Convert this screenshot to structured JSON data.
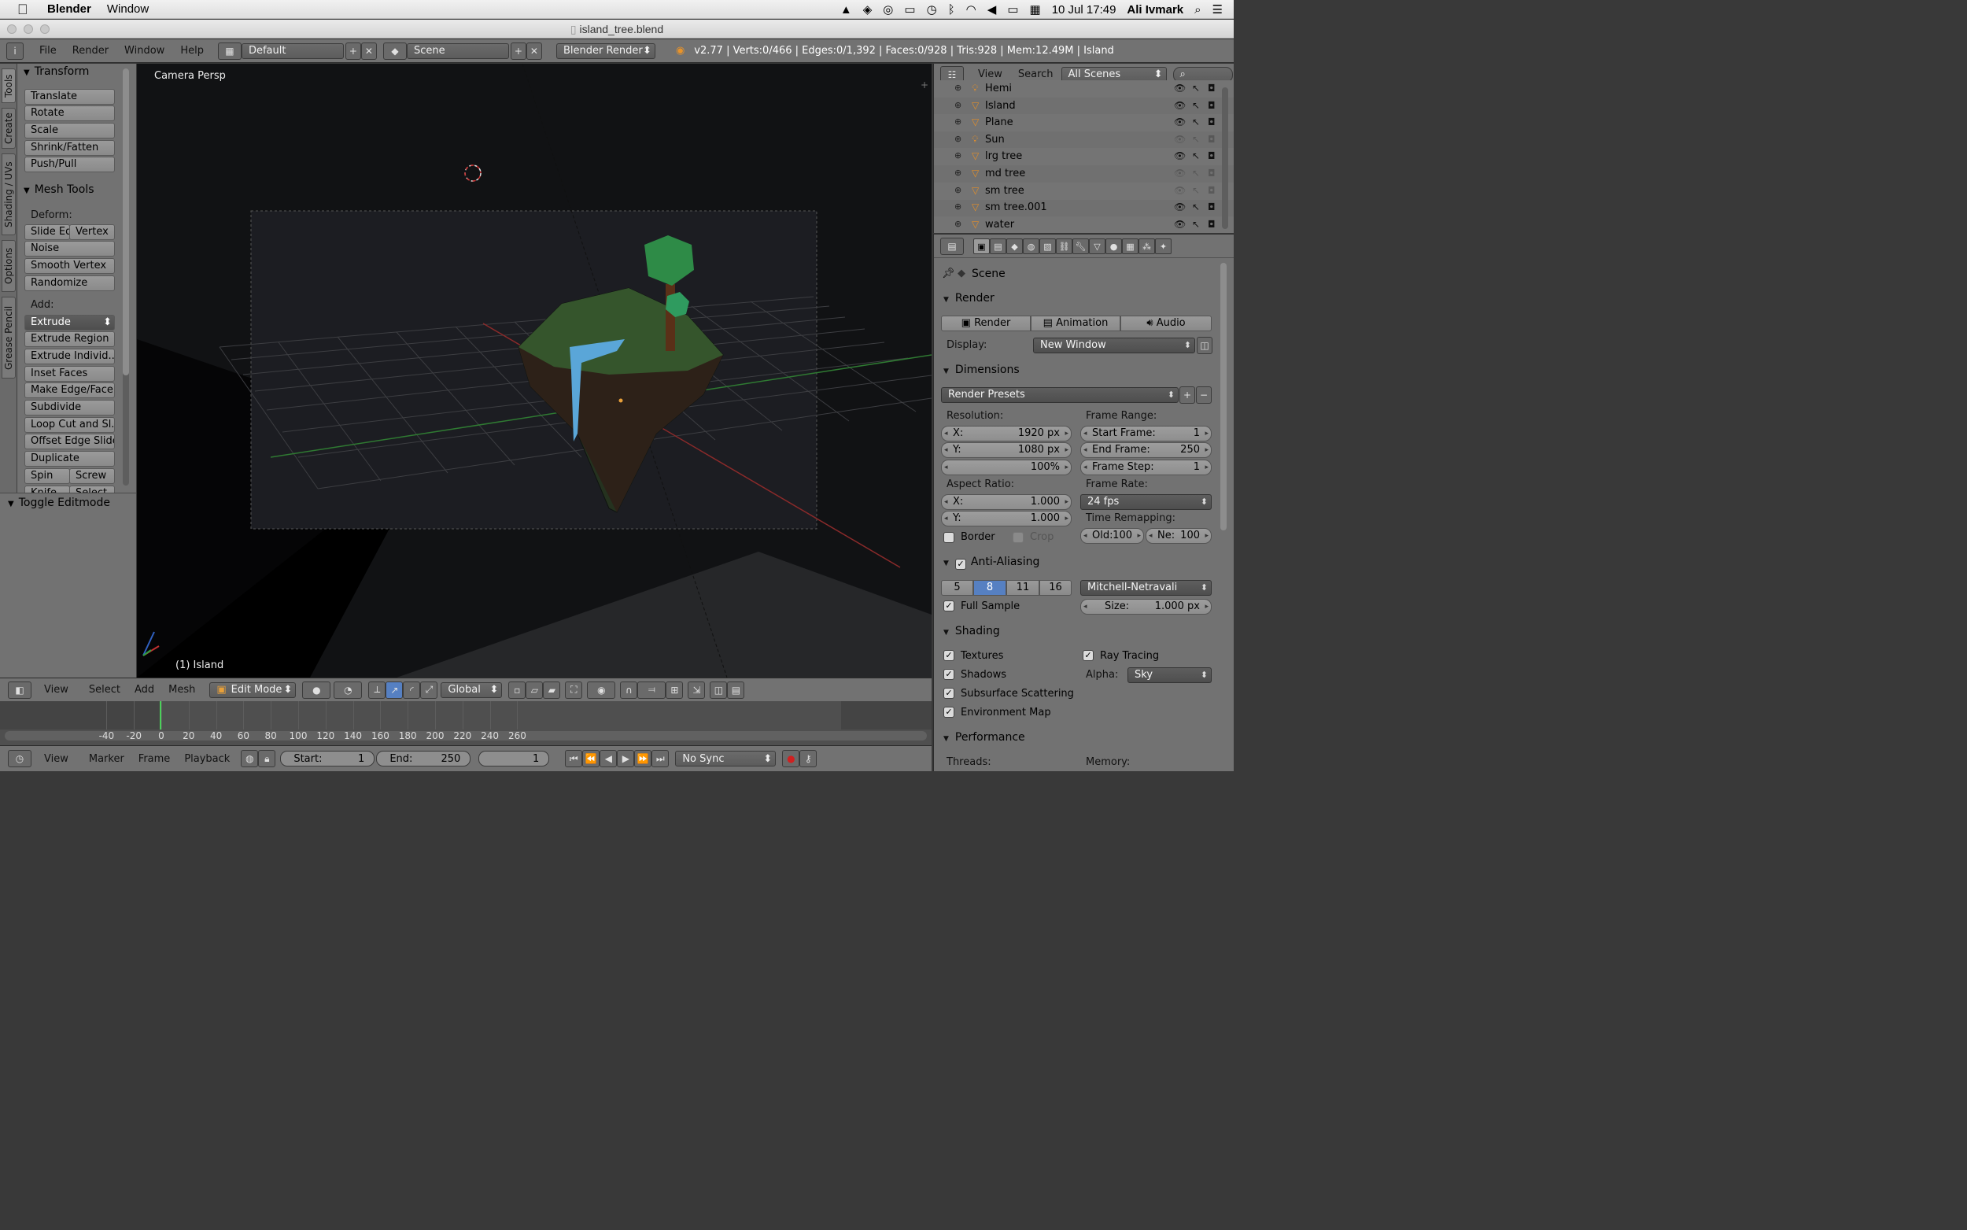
{
  "macbar": {
    "app_name": "Blender",
    "menu_window": "Window",
    "date_time": "10 Jul 17:49",
    "user": "Ali Ivmark"
  },
  "window": {
    "title": "island_tree.blend"
  },
  "infobar": {
    "menus": [
      "File",
      "Render",
      "Window",
      "Help"
    ],
    "screen_layout": "Default",
    "scene": "Scene",
    "engine": "Blender Render",
    "stats": "v2.77 | Verts:0/466 | Edges:0/1,392 | Faces:0/928 | Tris:928 | Mem:12.49M | Island"
  },
  "left_tabs": [
    "Tools",
    "Create",
    "Shading / UVs",
    "Options",
    "Grease Pencil"
  ],
  "toolshelf": {
    "transform": {
      "title": "Transform",
      "buttons": [
        "Translate",
        "Rotate",
        "Scale",
        "Shrink/Fatten",
        "Push/Pull"
      ]
    },
    "mesh_tools": {
      "title": "Mesh Tools",
      "deform_label": "Deform:",
      "slide_edge": "Slide Ed",
      "vertex": "Vertex",
      "deform_buttons": [
        "Noise",
        "Smooth Vertex",
        "Randomize"
      ],
      "add_label": "Add:",
      "extrude": "Extrude",
      "add_buttons": [
        "Extrude Region",
        "Extrude Individ...",
        "Inset Faces",
        "Make Edge/Face",
        "Subdivide",
        "Loop Cut and Sl...",
        "Offset Edge Slide",
        "Duplicate"
      ],
      "spin": "Spin",
      "screw": "Screw",
      "knife": "Knife",
      "select": "Select"
    },
    "operator": "Toggle Editmode"
  },
  "viewport": {
    "label": "Camera Persp",
    "object_label": "(1) Island"
  },
  "view3d_header": {
    "menus": [
      "View",
      "Select",
      "Add",
      "Mesh"
    ],
    "mode": "Edit Mode",
    "orientation": "Global"
  },
  "timeline": {
    "ticks": [
      -40,
      -20,
      0,
      20,
      40,
      60,
      80,
      100,
      120,
      140,
      160,
      180,
      200,
      220,
      240,
      260
    ],
    "menus": [
      "View",
      "Marker",
      "Frame",
      "Playback"
    ],
    "start_label": "Start:",
    "start_value": "1",
    "end_label": "End:",
    "end_value": "250",
    "current_frame": "1",
    "sync": "No Sync"
  },
  "outliner": {
    "menus": [
      "View",
      "Search"
    ],
    "filter": "All Scenes",
    "items": [
      {
        "name": "Hemi",
        "type": "lamp",
        "visible": true
      },
      {
        "name": "Island",
        "type": "mesh",
        "visible": true
      },
      {
        "name": "Plane",
        "type": "mesh",
        "visible": true
      },
      {
        "name": "Sun",
        "type": "lamp",
        "visible": false
      },
      {
        "name": "lrg tree",
        "type": "mesh",
        "visible": true
      },
      {
        "name": "md tree",
        "type": "mesh",
        "visible": false
      },
      {
        "name": "sm tree",
        "type": "mesh",
        "visible": false
      },
      {
        "name": "sm tree.001",
        "type": "mesh",
        "visible": true
      },
      {
        "name": "water",
        "type": "mesh",
        "visible": true
      }
    ]
  },
  "properties": {
    "breadcrumb": "Scene",
    "render": {
      "title": "Render",
      "render_btn": "Render",
      "animation_btn": "Animation",
      "audio_btn": "Audio",
      "display_label": "Display:",
      "display_value": "New Window"
    },
    "dimensions": {
      "title": "Dimensions",
      "presets": "Render Presets",
      "resolution_label": "Resolution:",
      "res_x_label": "X:",
      "res_x": "1920 px",
      "res_y_label": "Y:",
      "res_y": "1080 px",
      "res_pct": "100%",
      "frame_range_label": "Frame Range:",
      "start_label": "Start Frame:",
      "start": "1",
      "end_label": "End Frame:",
      "end": "250",
      "step_label": "Frame Step:",
      "step": "1",
      "aspect_label": "Aspect Ratio:",
      "asp_x_label": "X:",
      "asp_x": "1.000",
      "asp_y_label": "Y:",
      "asp_y": "1.000",
      "frame_rate_label": "Frame Rate:",
      "frame_rate": "24 fps",
      "time_remap_label": "Time Remapping:",
      "old_label": "Old:",
      "old": "100",
      "new_label": "Ne:",
      "new": "100",
      "border": "Border",
      "crop": "Crop"
    },
    "anti_aliasing": {
      "title": "Anti-Aliasing",
      "samples": [
        "5",
        "8",
        "11",
        "16"
      ],
      "selected_sample": "8",
      "filter": "Mitchell-Netravali",
      "full_sample": "Full Sample",
      "size_label": "Size:",
      "size": "1.000 px"
    },
    "shading": {
      "title": "Shading",
      "textures": "Textures",
      "ray_tracing": "Ray Tracing",
      "shadows": "Shadows",
      "alpha_label": "Alpha:",
      "alpha": "Sky",
      "sss": "Subsurface Scattering",
      "env_map": "Environment Map"
    },
    "performance": {
      "title": "Performance",
      "threads_label": "Threads:",
      "memory_label": "Memory:"
    }
  },
  "colors": {
    "accent_blue": "#5680c2",
    "grass": "#3b5a2a",
    "tree": "#2e8b47",
    "water": "#5aa6d8"
  }
}
